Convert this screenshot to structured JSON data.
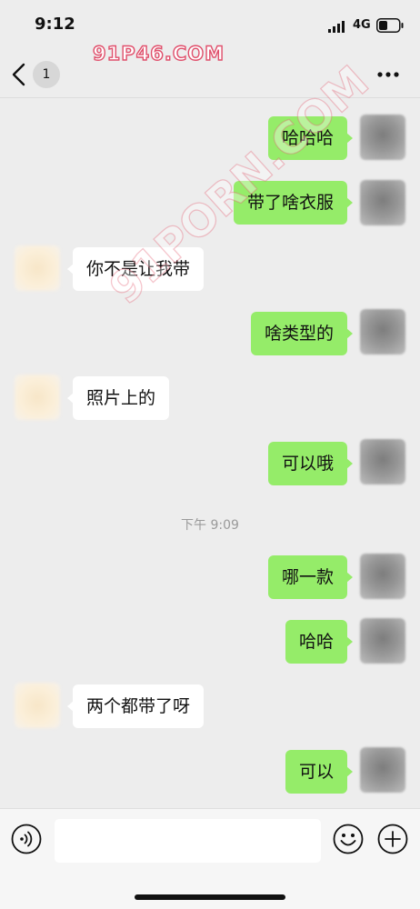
{
  "status_bar": {
    "time": "9:12",
    "network": "4G"
  },
  "nav": {
    "unread_count": "1",
    "watermark": "91P46.COM"
  },
  "chat": {
    "messages": [
      {
        "side": "self",
        "text": "哈哈哈"
      },
      {
        "side": "self",
        "text": "带了啥衣服"
      },
      {
        "side": "other",
        "text": "你不是让我带"
      },
      {
        "side": "self",
        "text": "啥类型的"
      },
      {
        "side": "other",
        "text": "照片上的"
      },
      {
        "side": "self",
        "text": "可以哦"
      },
      {
        "side": "self",
        "text": "哪一款"
      },
      {
        "side": "self",
        "text": "哈哈"
      },
      {
        "side": "other",
        "text": "两个都带了呀"
      },
      {
        "side": "self",
        "text": "可以"
      }
    ],
    "time_divider": "下午 9:09",
    "diagonal_watermark": "91PORN.COM"
  },
  "input_bar": {
    "value": "",
    "placeholder": ""
  },
  "icons": {
    "back": "chevron-left-icon",
    "more": "more-dots-icon",
    "voice": "voice-icon",
    "emoji": "emoji-icon",
    "add": "plus-icon"
  },
  "colors": {
    "self_bubble": "#95ec69",
    "other_bubble": "#ffffff",
    "background": "#ededed"
  }
}
